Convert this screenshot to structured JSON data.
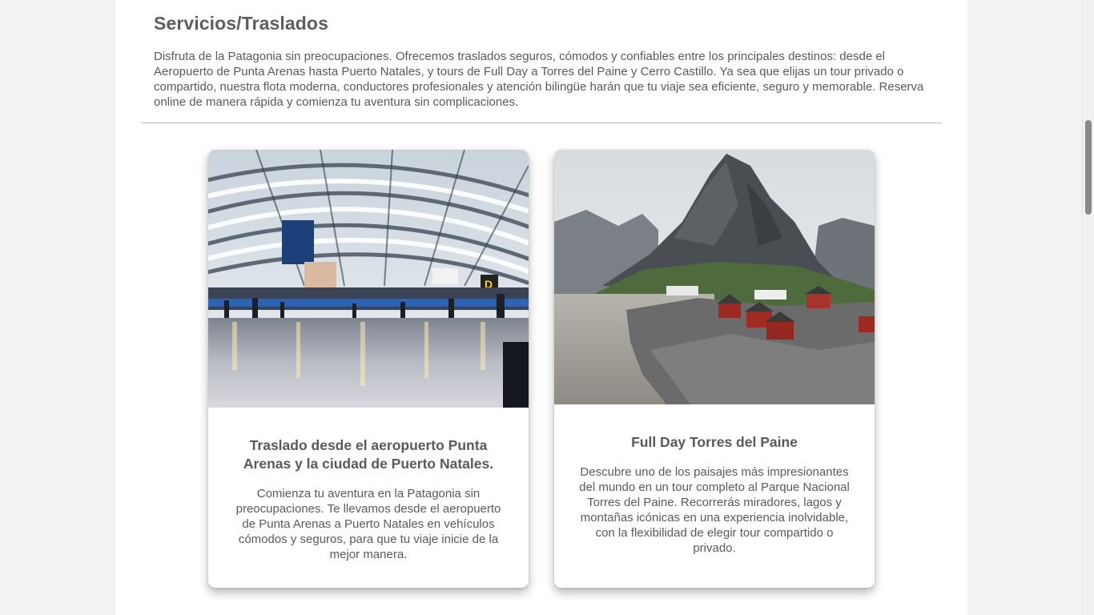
{
  "section": {
    "title": "Servicios/Traslados",
    "intro": "Disfruta de la Patagonia sin preocupaciones. Ofrecemos traslados seguros, cómodos y confiables entre los principales destinos: desde el Aeropuerto de Punta Arenas hasta Puerto Natales, y tours de Full Day a Torres del Paine y Cerro Castillo. Ya sea que elijas un tour privado o compartido, nuestra flota moderna, conductores profesionales y atención bilingüe harán que tu viaje sea eficiente, seguro y memorable. Reserva online de manera rápida y comienza tu aventura sin complicaciones."
  },
  "cards": [
    {
      "title": "Traslado desde el aeropuerto Punta Arenas y la ciudad de Puerto Natales.",
      "text": "Comienza tu aventura en la Patagonia sin preocupaciones. Te llevamos desde el aeropuerto de Punta Arenas a Puerto Natales en vehículos cómodos y seguros, para que tu viaje inicie de la mejor manera.",
      "image": "airport-terminal-photo"
    },
    {
      "title": "Full Day Torres del Paine",
      "text": "Descubre uno de los paisajes más impresionantes del mundo en un tour completo al Parque Nacional Torres del Paine. Recorrerás miradores, lagos y montañas icónicas en una experiencia inolvidable, con la flexibilidad de elegir tour compartido o privado.",
      "image": "mountain-village-photo"
    }
  ],
  "colors": {
    "page_background": "#f2f2f2",
    "content_background": "#ffffff",
    "text": "#5a5a5a",
    "divider": "#bdbdbd"
  }
}
